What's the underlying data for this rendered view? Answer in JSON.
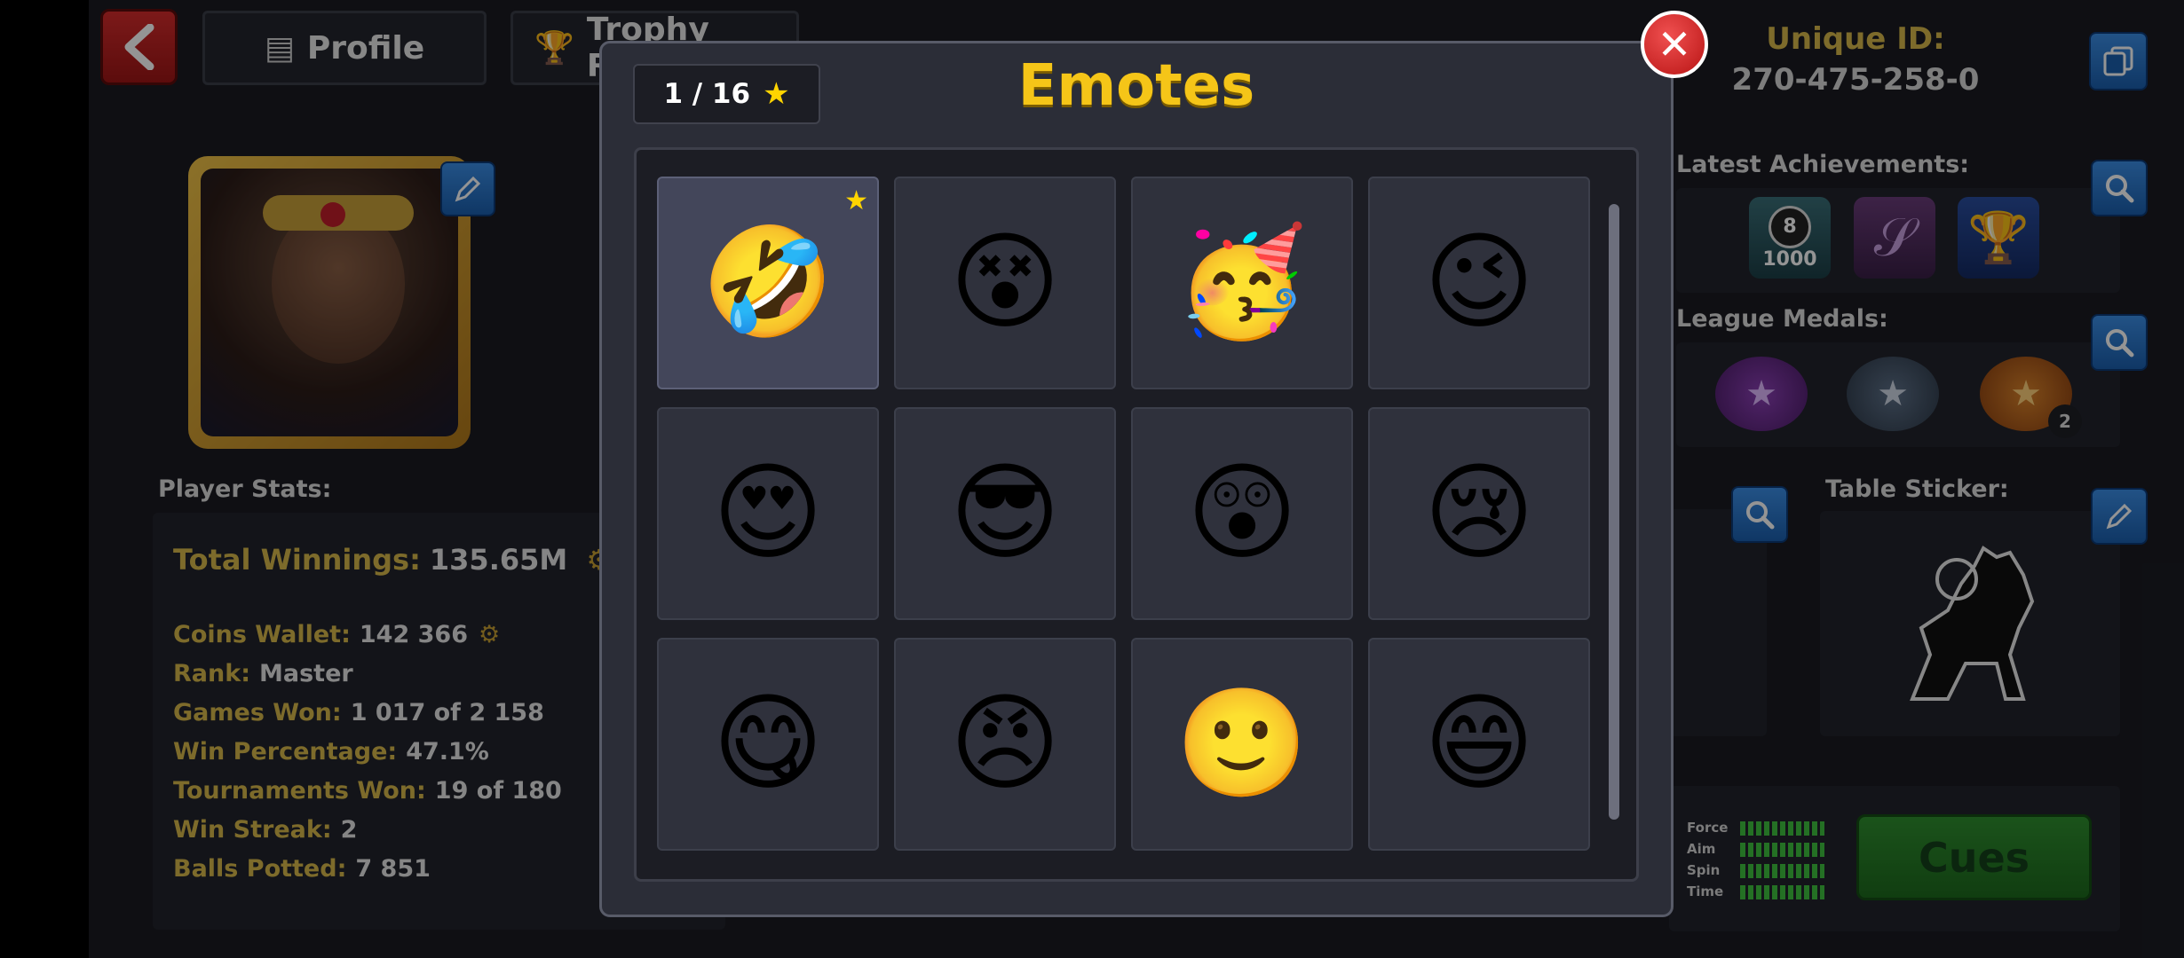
{
  "header": {
    "profile_tab": "Profile",
    "trophy_tab": "Trophy Road",
    "unique_id_label": "Unique ID:",
    "unique_id_value": "270-475-258-0"
  },
  "sections": {
    "player_stats_label": "Player Stats:",
    "latest_achievements_label": "Latest Achievements:",
    "league_medals_label": "League Medals:",
    "table_sticker_label": "Table Sticker:"
  },
  "stats": {
    "total_winnings_label": "Total Winnings:",
    "total_winnings_value": "135.65M",
    "rows": [
      {
        "label": "Coins Wallet:",
        "value": "142 366"
      },
      {
        "label": "Rank:",
        "value": "Master"
      },
      {
        "label": "Games Won:",
        "value": "1 017 of 2 158"
      },
      {
        "label": "Win Percentage:",
        "value": "47.1%"
      },
      {
        "label": "Tournaments Won:",
        "value": "19 of 180"
      },
      {
        "label": "Win Streak:",
        "value": "2"
      },
      {
        "label": "Balls Potted:",
        "value": "7 851"
      }
    ]
  },
  "achievement_badge_text": "1000",
  "medal_count": "2",
  "cue_meters": [
    "Force",
    "Aim",
    "Spin",
    "Time"
  ],
  "cues_button": "Cues",
  "modal": {
    "title": "Emotes",
    "counter": "1 / 16",
    "emotes": [
      "🤣",
      "😵",
      "🥳",
      "😉",
      "😍",
      "😎",
      "😲",
      "😢",
      "😋",
      "😠",
      "🙂",
      "😄"
    ]
  }
}
